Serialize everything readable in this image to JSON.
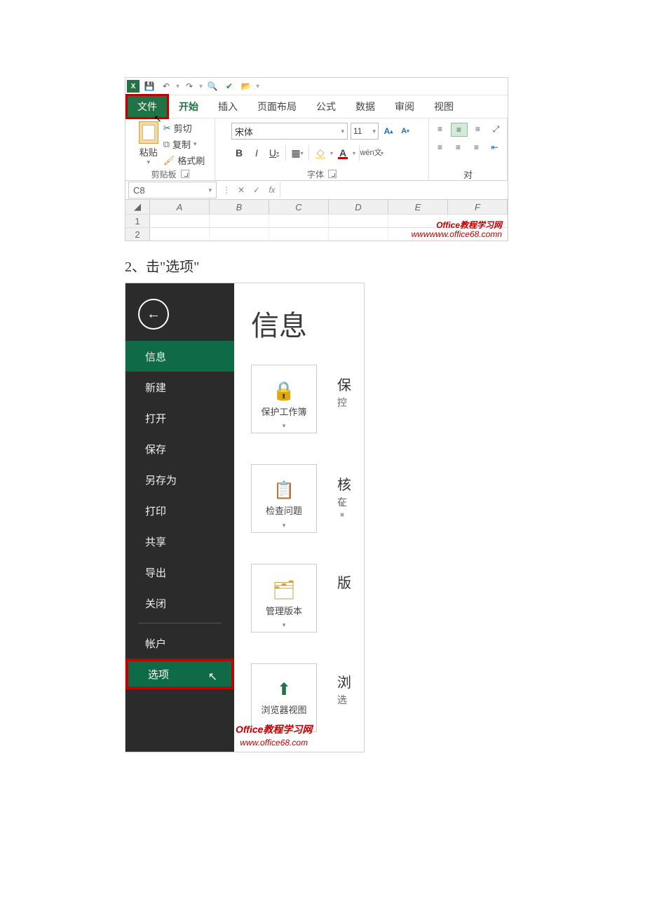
{
  "qat": {
    "undo": "↶",
    "redo": "↷",
    "preview": "🔍",
    "spell": "✔",
    "open": "📂"
  },
  "tabs": {
    "file": "文件",
    "home": "开始",
    "insert": "插入",
    "layout": "页面布局",
    "formulas": "公式",
    "data": "数据",
    "review": "审阅",
    "view": "视图"
  },
  "ribbon": {
    "clipboard": {
      "paste": "粘贴",
      "cut": "剪切",
      "copy": "复制",
      "painter": "格式刷",
      "group": "剪贴板"
    },
    "font": {
      "name": "宋体",
      "size": "11",
      "bold": "B",
      "italic": "I",
      "underline": "U",
      "wen_top": "wén",
      "wen_bottom": "文",
      "group": "字体"
    },
    "align": {
      "group": "对"
    }
  },
  "namebox": "C8",
  "fx_label": "fx",
  "columns": [
    "A",
    "B",
    "C",
    "D",
    "E",
    "F"
  ],
  "rows": [
    "1",
    "2"
  ],
  "watermark1": {
    "line1": "Office教程学习网",
    "line2": "wwwwww.office68.comn"
  },
  "step_text": "2、击\"选项\"",
  "backstage": {
    "title": "信息",
    "items": {
      "info": "信息",
      "new": "新建",
      "open": "打开",
      "save": "保存",
      "saveas": "另存为",
      "print": "打印",
      "share": "共享",
      "export": "导出",
      "close": "关闭",
      "account": "帐户",
      "options": "选项"
    },
    "cards": {
      "protect": "保护工作簿",
      "inspect": "检查问题",
      "versions": "管理版本",
      "browser": "浏览器视图"
    },
    "side_chars": {
      "a": "保",
      "a2": "控",
      "b": "核",
      "b2": "在",
      "c": "版",
      "d": "浏",
      "d2": "选"
    }
  },
  "watermark2": {
    "line1": "Office教程学习网",
    "line2": "www.office68.com"
  }
}
